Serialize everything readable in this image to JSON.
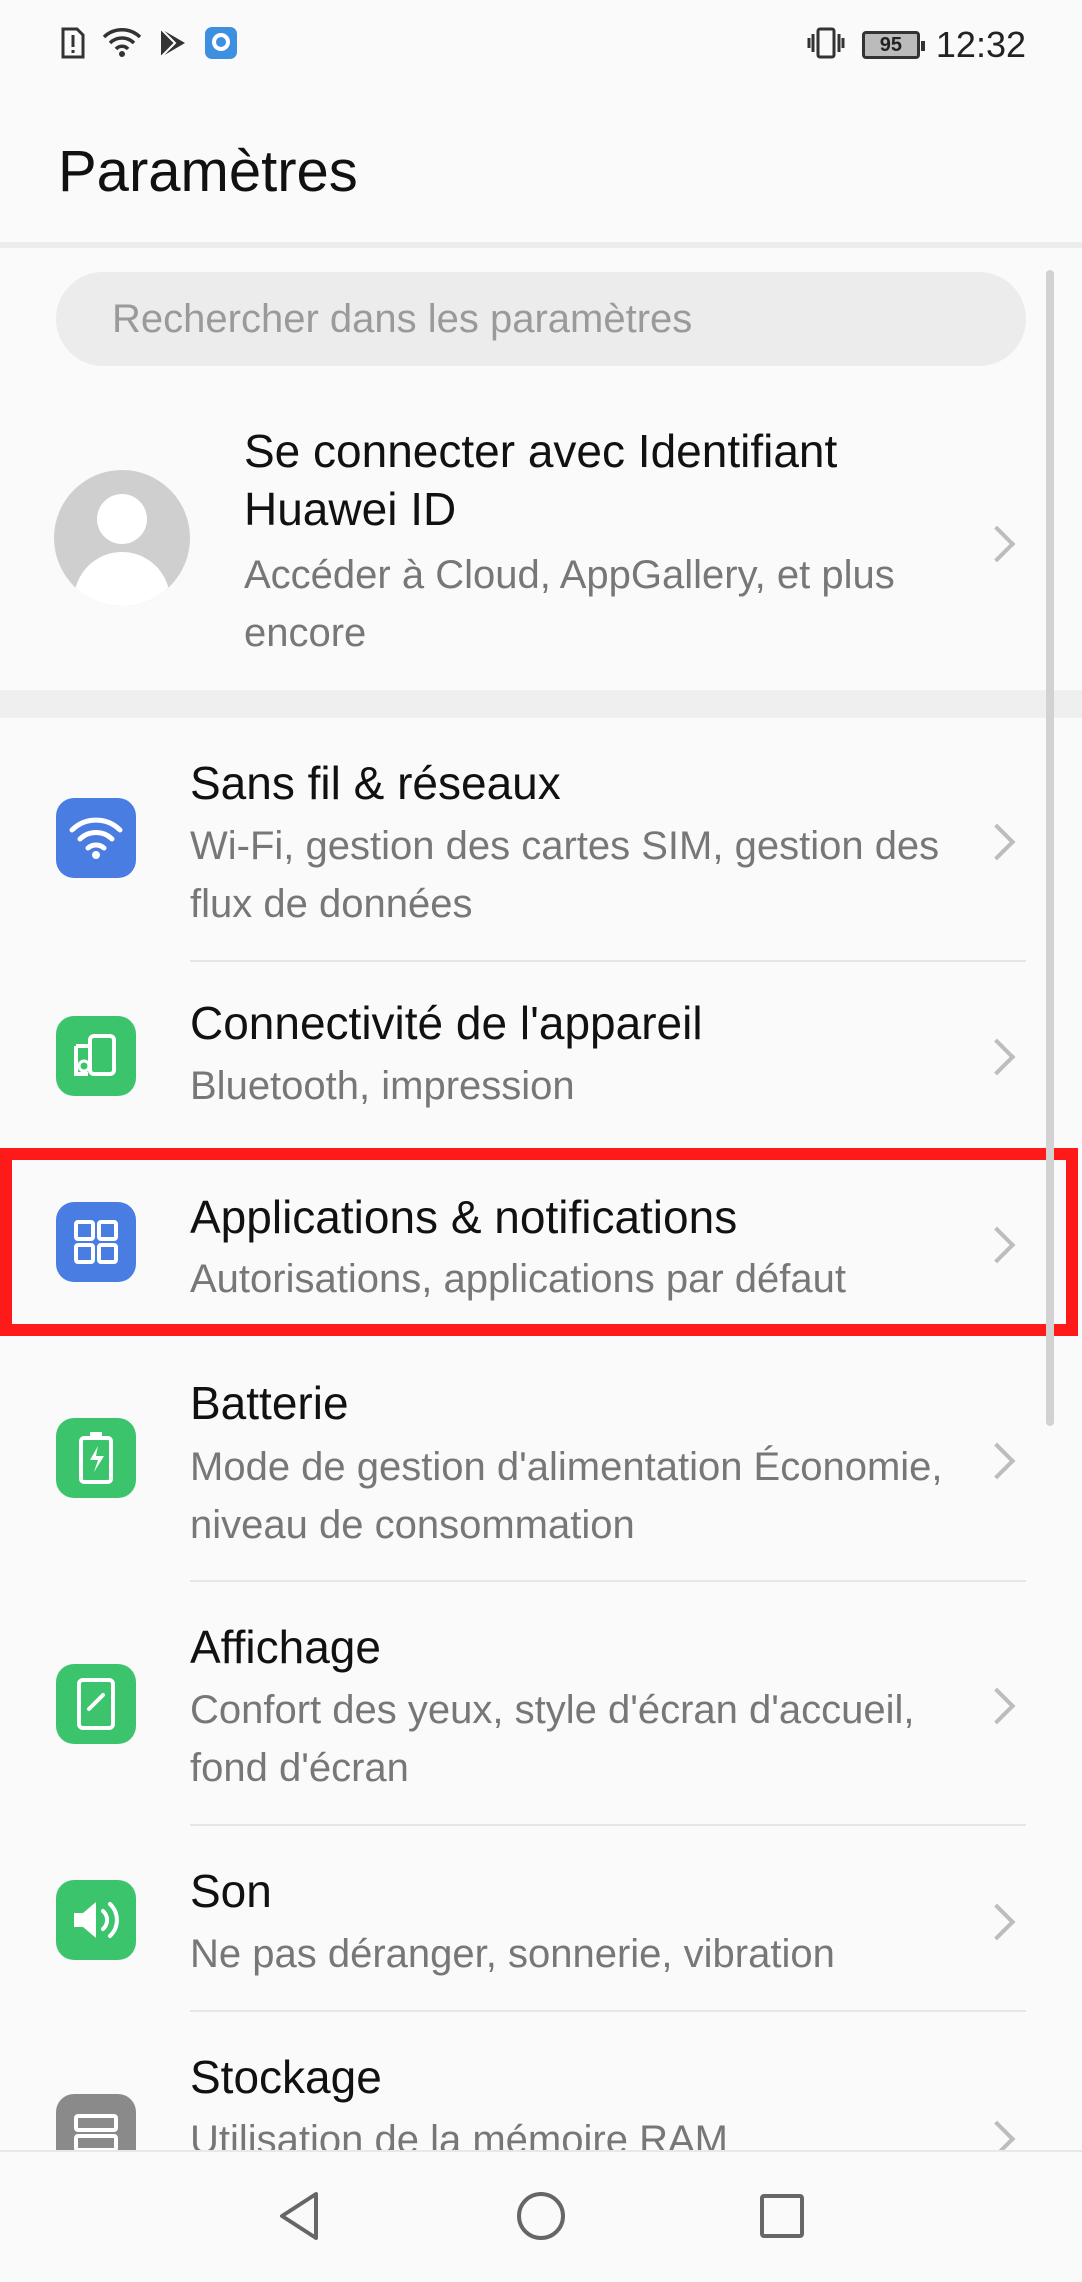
{
  "status_bar": {
    "time": "12:32",
    "battery": "95",
    "icons": [
      "sim-alert-icon",
      "wifi-icon",
      "play-store-icon",
      "assistant-app-icon",
      "vibrate-icon",
      "battery-icon"
    ]
  },
  "header": {
    "title": "Paramètres"
  },
  "search": {
    "placeholder": "Rechercher dans les paramètres"
  },
  "account": {
    "title": "Se connecter avec Identifiant Huawei ID",
    "subtitle": "Accéder à Cloud, AppGallery, et plus encore"
  },
  "items": [
    {
      "title": "Sans fil & réseaux",
      "subtitle": "Wi-Fi, gestion des cartes SIM, gestion des flux de données",
      "icon": "wifi-icon",
      "color": "#4a7de2"
    },
    {
      "title": "Connectivité de l'appareil",
      "subtitle": "Bluetooth, impression",
      "icon": "device-connectivity-icon",
      "color": "#3cc46c"
    },
    {
      "title": "Applications & notifications",
      "subtitle": "Autorisations, applications par défaut",
      "icon": "apps-grid-icon",
      "color": "#4a7de2"
    },
    {
      "title": "Batterie",
      "subtitle": "Mode de gestion d'alimentation Économie, niveau de consommation",
      "icon": "battery-charge-icon",
      "color": "#3cc46c"
    },
    {
      "title": "Affichage",
      "subtitle": "Confort des yeux, style d'écran d'accueil, fond d'écran",
      "icon": "display-icon",
      "color": "#3cc46c"
    },
    {
      "title": "Son",
      "subtitle": "Ne pas déranger, sonnerie, vibration",
      "icon": "sound-icon",
      "color": "#3cc46c"
    },
    {
      "title": "Stockage",
      "subtitle": "Utilisation de la mémoire RAM",
      "icon": "storage-icon",
      "color": "#8a8a8a"
    }
  ],
  "highlight_color": "#ff1a1a",
  "nav": [
    "back-icon",
    "home-icon",
    "recents-icon"
  ]
}
